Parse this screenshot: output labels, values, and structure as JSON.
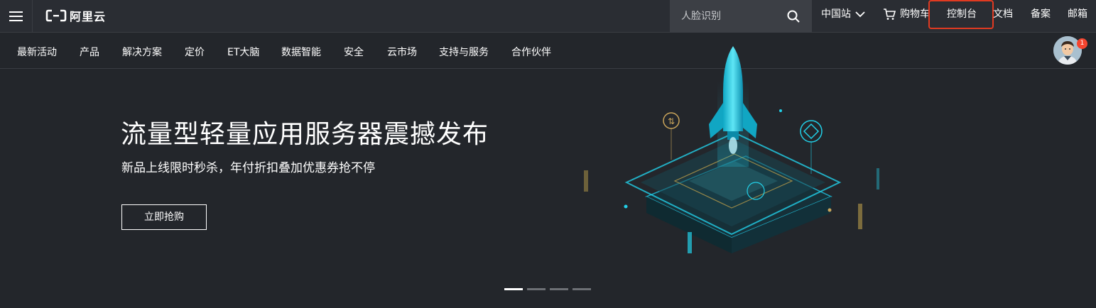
{
  "header": {
    "logo_text": "阿里云",
    "search": {
      "placeholder": "人脸识别"
    },
    "region_label": "中国站",
    "cart_label": "购物车",
    "console_label": "控制台",
    "docs_label": "文档",
    "beian_label": "备案",
    "mail_label": "邮箱"
  },
  "nav": {
    "items": [
      {
        "label": "最新活动"
      },
      {
        "label": "产品"
      },
      {
        "label": "解决方案"
      },
      {
        "label": "定价"
      },
      {
        "label": "ET大脑"
      },
      {
        "label": "数据智能"
      },
      {
        "label": "安全"
      },
      {
        "label": "云市场"
      },
      {
        "label": "支持与服务"
      },
      {
        "label": "合作伙伴"
      }
    ]
  },
  "user": {
    "notification_count": "1"
  },
  "hero": {
    "title": "流量型轻量应用服务器震撼发布",
    "subtitle": "新品上线限时秒杀，年付折扣叠加优惠券抢不停",
    "cta_label": "立即抢购"
  },
  "carousel": {
    "slide_count": 4,
    "active_index": 0
  },
  "colors": {
    "background": "#23262b",
    "highlight_border": "#e13a21",
    "accent": "#20c6e0",
    "badge": "#f5452f"
  }
}
